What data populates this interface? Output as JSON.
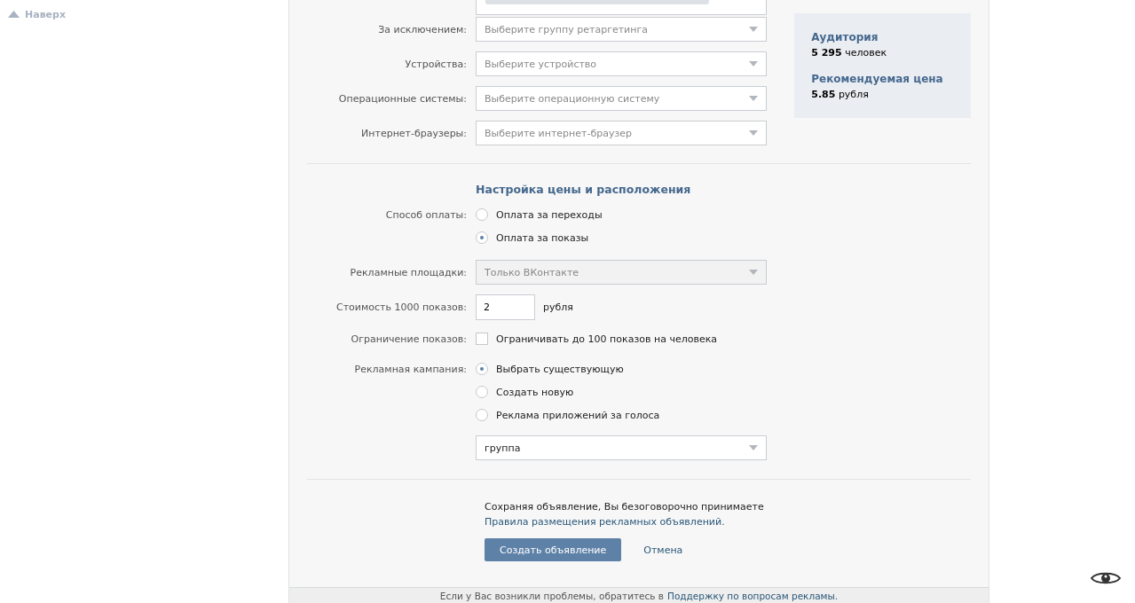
{
  "back_to_top": {
    "label": "Наверх"
  },
  "targeting": [
    {
      "label": "За исключением:",
      "placeholder": "Выберите группу ретаргетинга"
    },
    {
      "label": "Устройства:",
      "placeholder": "Выберите устройство"
    },
    {
      "label": "Операционные системы:",
      "placeholder": "Выберите операционную систему"
    },
    {
      "label": "Интернет-браузеры:",
      "placeholder": "Выберите интернет-браузер"
    }
  ],
  "audience": {
    "title": "Аудитория",
    "value": "5 295",
    "unit": "человек"
  },
  "price": {
    "title": "Рекомендуемая цена",
    "value": "5.85",
    "unit": "рубля"
  },
  "pricing": {
    "heading": "Настройка цены и расположения",
    "payment": {
      "label": "Способ оплаты:",
      "options": [
        {
          "label": "Оплата за переходы",
          "selected": false
        },
        {
          "label": "Оплата за показы",
          "selected": true
        }
      ]
    },
    "platforms": {
      "label": "Рекламные площадки:",
      "value": "Только ВКонтакте",
      "disabled": true
    },
    "cost": {
      "label": "Стоимость 1000 показов:",
      "value": "2",
      "unit": "рубля"
    },
    "limit": {
      "label": "Ограничение показов:",
      "text": "Ограничивать до 100 показов на человека",
      "checked": false
    },
    "campaign": {
      "label": "Рекламная кампания:",
      "options": [
        {
          "label": "Выбрать существующую",
          "selected": true
        },
        {
          "label": "Создать новую",
          "selected": false
        },
        {
          "label": "Реклама приложений за голоса",
          "selected": false
        }
      ],
      "value": "группа"
    }
  },
  "agreement": {
    "text": "Сохраняя объявление, Вы безоговорочно принимаете",
    "link": "Правила размещения рекламных объявлений."
  },
  "buttons": {
    "submit": "Создать объявление",
    "cancel": "Отмена"
  },
  "footer": {
    "text": "Если у Вас возникли проблемы, обратитесь в",
    "link": "Поддержку по вопросам рекламы."
  }
}
